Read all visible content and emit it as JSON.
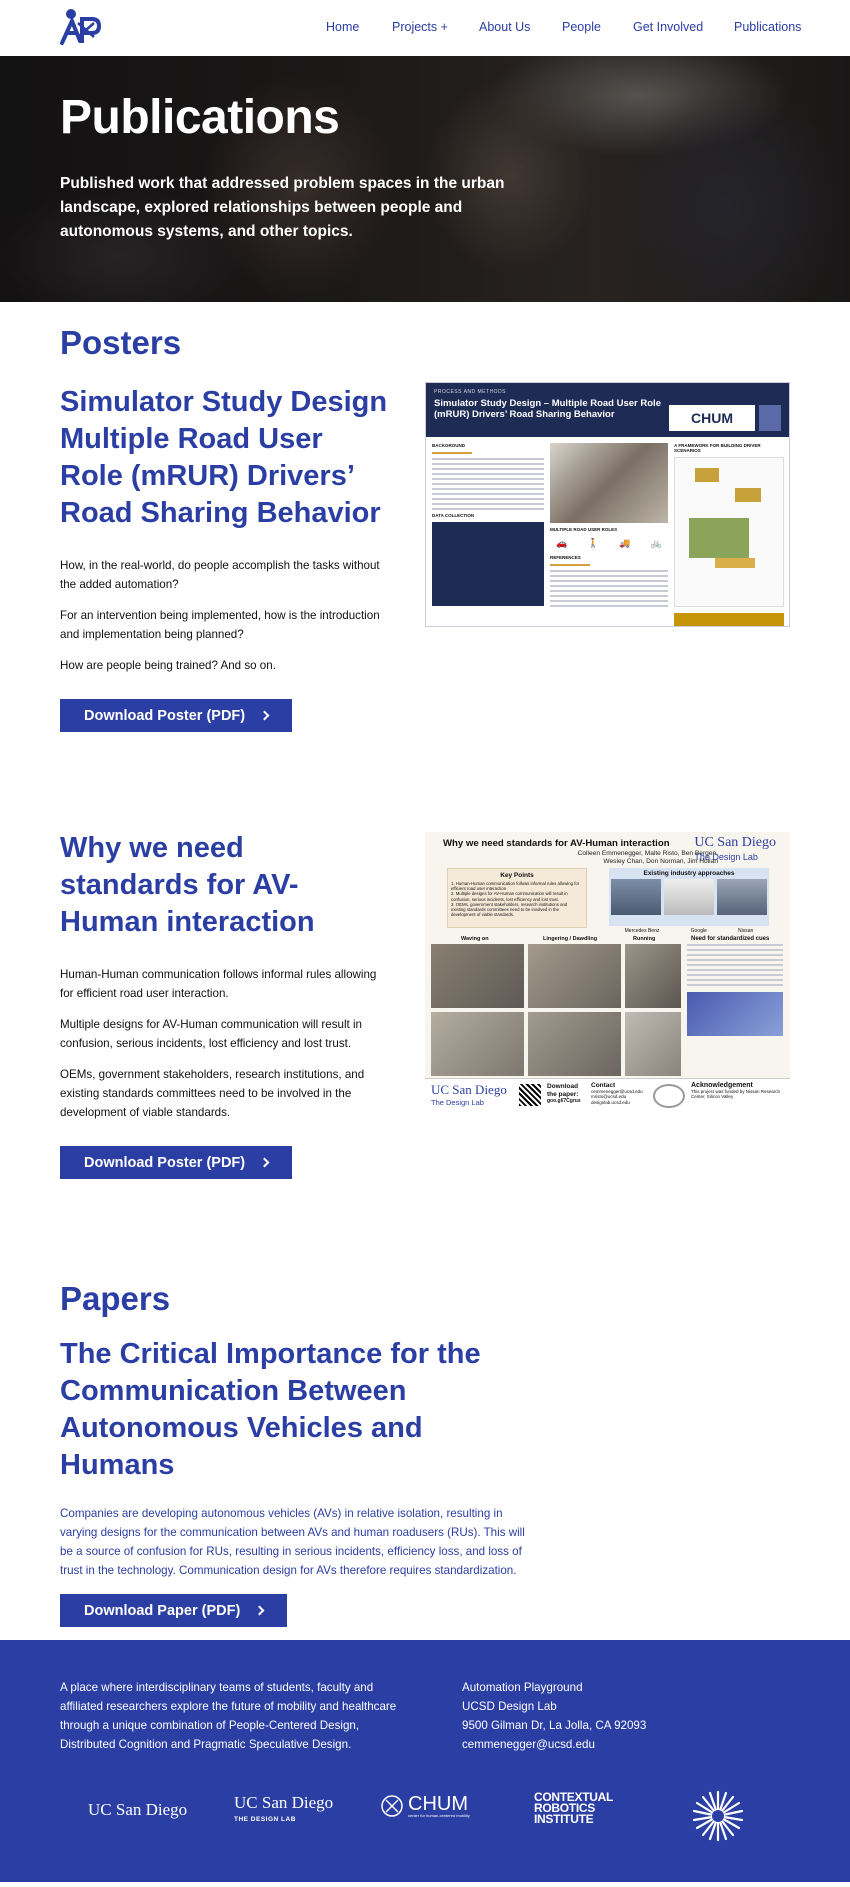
{
  "nav": {
    "items": [
      {
        "label": "Home"
      },
      {
        "label": "Projects +"
      },
      {
        "label": "About Us"
      },
      {
        "label": "People"
      },
      {
        "label": "Get Involved"
      },
      {
        "label": "Publications"
      }
    ]
  },
  "hero": {
    "title": "Publications",
    "subtitle": "Published work that addressed problem spaces in the urban landscape, explored relationships between people and autonomous systems, and other topics."
  },
  "posters": {
    "heading": "Posters",
    "items": [
      {
        "title": "Simulator Study Design Multiple Road User Role (mRUR) Drivers’ Road Sharing Behavior",
        "paragraphs": [
          "How, in the real-world, do people accomplish the tasks without the added automation?",
          "For an intervention being implemented, how is the introduction and implementation being planned?",
          "How are people being trained? And so on."
        ],
        "button": "Download Poster (PDF)",
        "thumb": {
          "kicker": "PROCESS AND METHODS",
          "title": "Simulator Study Design – Multiple Road User Role (mRUR) Drivers’ Road Sharing Behavior",
          "logo": "CHUM",
          "sections": [
            "BACKGROUND",
            "DATA COLLECTION",
            "MULTIPLE ROAD USER ROLES",
            "REFERENCES",
            "A FRAMEWORK FOR BUILDING DRIVER SCENARIOS"
          ]
        }
      },
      {
        "title": "Why we need standards for AV-Human interaction",
        "paragraphs": [
          "Human-Human communication follows informal rules allowing for efficient road user interaction.",
          "Multiple designs for AV-Human communication will result in confusion, serious incidents, lost efficiency and lost trust.",
          "OEMs, government stakeholders, research institutions, and existing standards committees need to be involved in the development of viable standards."
        ],
        "button": "Download Poster (PDF)",
        "thumb": {
          "title": "Why we need standards for AV-Human interaction",
          "authors_line1": "Colleen Emmenegger, Malte Risto, Ben Bergen,",
          "authors_line2": "Wesley Chan, Don Norman, Jim Hollan",
          "ucsd": "UC San Diego",
          "ucsd_sub": "The Design Lab",
          "key_points": "Key Points",
          "key_points_list": [
            "1. Human-Human communication follows informal rules allowing for efficient road user interaction",
            "2. Multiple designs for AV-Human communication will result in confusion, serious incidents, lost efficiency and lost trust.",
            "3. OEMs, government stakeholders, research institutions and existing standards committees need to be involved in the development of viable standards."
          ],
          "existing": "Existing industry approaches",
          "brands": [
            "Mercedes Benz",
            "Google",
            "Nissan"
          ],
          "col_labels": [
            "Waving on",
            "Lingering / Dawdling",
            "Running"
          ],
          "need": "Need for standardized cues",
          "download": "Download the paper:",
          "download_url": "goo.gl/7Cgrus",
          "contact": "Contact",
          "contact_lines": [
            "cemmenegger@ucsd.edu",
            "mristo@ucsd.edu",
            "designlab.ucsd.edu"
          ],
          "ack": "Acknowledgement",
          "ack_text": "This project was funded by Nissan Research Center, Silicon Valley"
        }
      }
    ]
  },
  "papers": {
    "heading": "Papers",
    "items": [
      {
        "title": "The Critical Importance for the Communication Between Autonomous Vehicles and Humans",
        "abstract": "Companies are developing autonomous vehicles (AVs) in relative isolation, resulting in varying designs for the communication between AVs and human roadusers (RUs). This will be a source of confusion for RUs, resulting in serious incidents, efficiency loss, and loss of trust in the technology. Communication design for AVs therefore requires standardization.",
        "button": "Download Paper (PDF)"
      }
    ]
  },
  "footer": {
    "about": "A place where interdisciplinary teams of students, faculty and affiliated researchers explore the future of mobility and healthcare through a unique combination of People-Centered Design, Distributed Cognition and Pragmatic Speculative Design.",
    "address": [
      "Automation Playground",
      "UCSD Design Lab",
      "9500 Gilman Dr, La Jolla, CA 92093",
      "cemmenegger@ucsd.edu"
    ],
    "logos": {
      "ucsd": "UC San Diego",
      "designlab_top": "UC San Diego",
      "designlab_sub": "THE DESIGN LAB",
      "chum": "CHUM",
      "chum_sub": "center for human-centered mobility",
      "cri": [
        "CONTEXTUAL",
        "ROBOTICS",
        "INSTITUTE"
      ]
    }
  },
  "colors": {
    "brand": "#2b3ea3",
    "poster_navy": "#1e2b55",
    "accent": "#d69f3a"
  }
}
